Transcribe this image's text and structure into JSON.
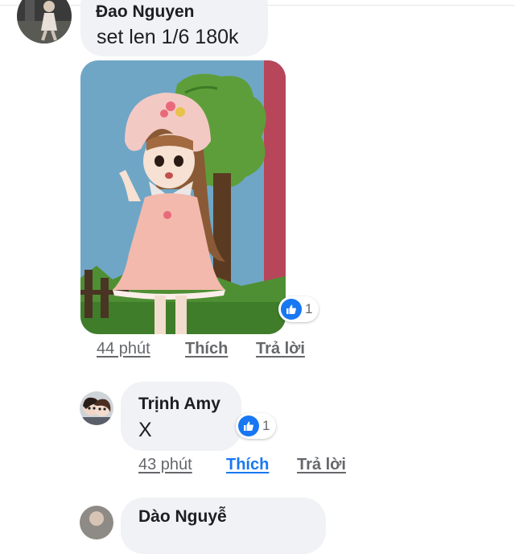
{
  "comments": [
    {
      "author": "Đao Nguyen",
      "text": "set len 1/6 180k",
      "reaction_count": "1",
      "time": "44 phút",
      "like_label": "Thích",
      "reply_label": "Trả lời"
    },
    {
      "author": "Trịnh Amy",
      "text": "X",
      "reaction_count": "1",
      "time": "43 phút",
      "like_label": "Thích",
      "reply_label": "Trả lời"
    },
    {
      "author": "Dào Nguyễ"
    }
  ],
  "colors": {
    "accent": "#1877f2",
    "bubble": "#f0f2f5",
    "meta": "#65676b"
  },
  "icons": [
    "thumbs-up-icon",
    "avatar-image",
    "doll-photo"
  ]
}
